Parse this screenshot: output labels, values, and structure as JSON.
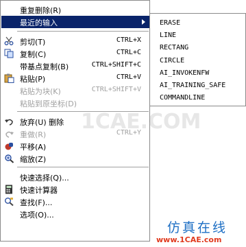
{
  "menu": {
    "items": [
      {
        "label": "重复删除(R)",
        "shortcut": ""
      },
      {
        "label": "最近的输入",
        "shortcut": ""
      },
      {
        "label": "剪切(T)",
        "shortcut": "CTRL+X"
      },
      {
        "label": "复制(C)",
        "shortcut": "CTRL+C"
      },
      {
        "label": "带基点复制(B)",
        "shortcut": "CTRL+SHIFT+C"
      },
      {
        "label": "粘贴(P)",
        "shortcut": "CTRL+V"
      },
      {
        "label": "粘贴为块(K)",
        "shortcut": "CTRL+SHIFT+V"
      },
      {
        "label": "粘贴到原坐标(D)",
        "shortcut": ""
      },
      {
        "label": "放弃(U) 删除",
        "shortcut": ""
      },
      {
        "label": "重做(R)",
        "shortcut": "CTRL+Y"
      },
      {
        "label": "平移(A)",
        "shortcut": ""
      },
      {
        "label": "缩放(Z)",
        "shortcut": ""
      },
      {
        "label": "快速选择(Q)...",
        "shortcut": ""
      },
      {
        "label": "快速计算器",
        "shortcut": ""
      },
      {
        "label": "查找(F)...",
        "shortcut": ""
      },
      {
        "label": "选项(O)...",
        "shortcut": ""
      }
    ]
  },
  "submenu": {
    "items": [
      "ERASE",
      "LINE",
      "RECTANG",
      "CIRCLE",
      "AI_INVOKENFW",
      "AI_TRAINING_SAFE",
      "COMMANDLINE"
    ]
  },
  "watermark": "1CAE.COM",
  "brand": {
    "title": "仿真在线",
    "url": "www.1CAE.com"
  },
  "colors": {
    "highlight": "#0a246a",
    "disabled": "#a0a0a0"
  }
}
